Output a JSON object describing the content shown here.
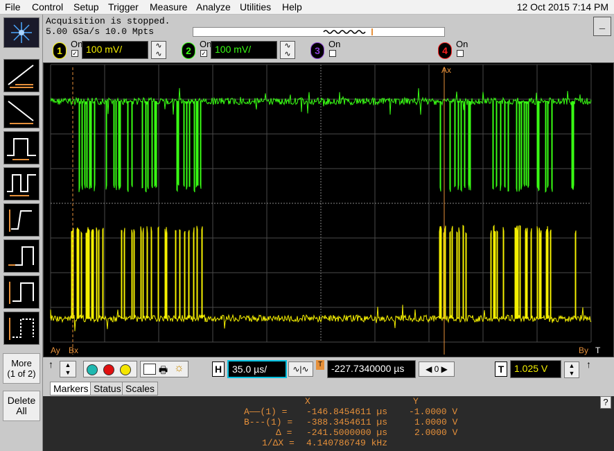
{
  "menu": {
    "items": [
      "File",
      "Control",
      "Setup",
      "Trigger",
      "Measure",
      "Analyze",
      "Utilities",
      "Help"
    ],
    "datetime": "12 Oct 2015  7:14 PM"
  },
  "status": {
    "acquisition": "Acquisition is stopped.",
    "rate": "5.00 GSa/s  10.0 Mpts",
    "minimize": "_"
  },
  "channels": [
    {
      "num": "1",
      "on": "On",
      "checked": true,
      "scale": "100 mV/",
      "color": "#f5f000",
      "cpl": "~\n~"
    },
    {
      "num": "2",
      "on": "On",
      "checked": true,
      "scale": "100 mV/",
      "color": "#39ff14",
      "cpl": "~\n~"
    },
    {
      "num": "3",
      "on": "On",
      "checked": false,
      "scale": "",
      "color": "#8a3fd6",
      "cpl": ""
    },
    {
      "num": "4",
      "on": "On",
      "checked": false,
      "scale": "",
      "color": "#ff2020",
      "cpl": ""
    }
  ],
  "side": {
    "more": "More\n(1 of 2)",
    "delete": "Delete\nAll"
  },
  "plot": {
    "labels": {
      "ay": "Ay",
      "bx": "Bx",
      "ax": "Ax",
      "by": "By"
    },
    "trigger_level_label": "T"
  },
  "bottom": {
    "h_label": "H",
    "h_scale": "35.0 µs/",
    "t_label": "T",
    "delay": "-227.7340000 µs",
    "delay_step": "0",
    "trig_level": "1.025 V"
  },
  "tabs": [
    "Markers",
    "Status",
    "Scales"
  ],
  "markers": {
    "header_x": "X",
    "header_y": "Y",
    "rows": [
      {
        "label": "A——(1) =",
        "x": "-146.8454611 µs",
        "y": "-1.0000 V"
      },
      {
        "label": "B---(1) =",
        "x": "-388.3454611 µs",
        "y": "1.0000 V"
      },
      {
        "label": "Δ =",
        "x": "-241.5000000 µs",
        "y": "2.0000 V"
      },
      {
        "label": "1/ΔX =",
        "x": "4.140786749 kHz",
        "y": ""
      }
    ],
    "help": "?"
  },
  "colors": {
    "ch1": "#f5f000",
    "ch2": "#39ff14",
    "marker": "#e6903a",
    "grid": "#5a5a5a"
  }
}
